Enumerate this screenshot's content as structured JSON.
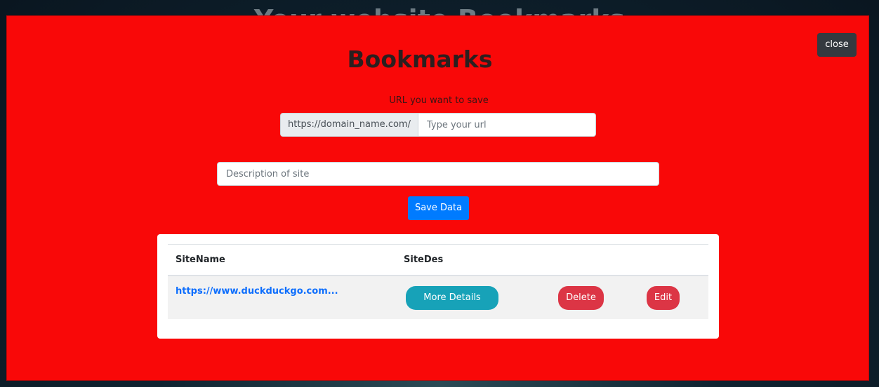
{
  "background": {
    "title": "Your website Bookmarks"
  },
  "modal": {
    "close_label": "close",
    "title": "Bookmarks",
    "url_label": "URL you want to save",
    "url_prefix": "https://domain_name.com/",
    "url_value": "",
    "url_placeholder": "Type your url",
    "description_value": "",
    "description_placeholder": "Description of site",
    "save_label": "Save Data"
  },
  "table": {
    "columns": [
      "SiteName",
      "SiteDes"
    ],
    "rows": [
      {
        "site_name": "https://www.duckduckgo.com...",
        "more_label": "More Details",
        "delete_label": "Delete",
        "edit_label": "Edit"
      }
    ]
  },
  "colors": {
    "modal_background": "#f90808",
    "primary": "#007bff",
    "info": "#17a2b8",
    "danger": "#dc3545",
    "dark": "#343a40"
  }
}
